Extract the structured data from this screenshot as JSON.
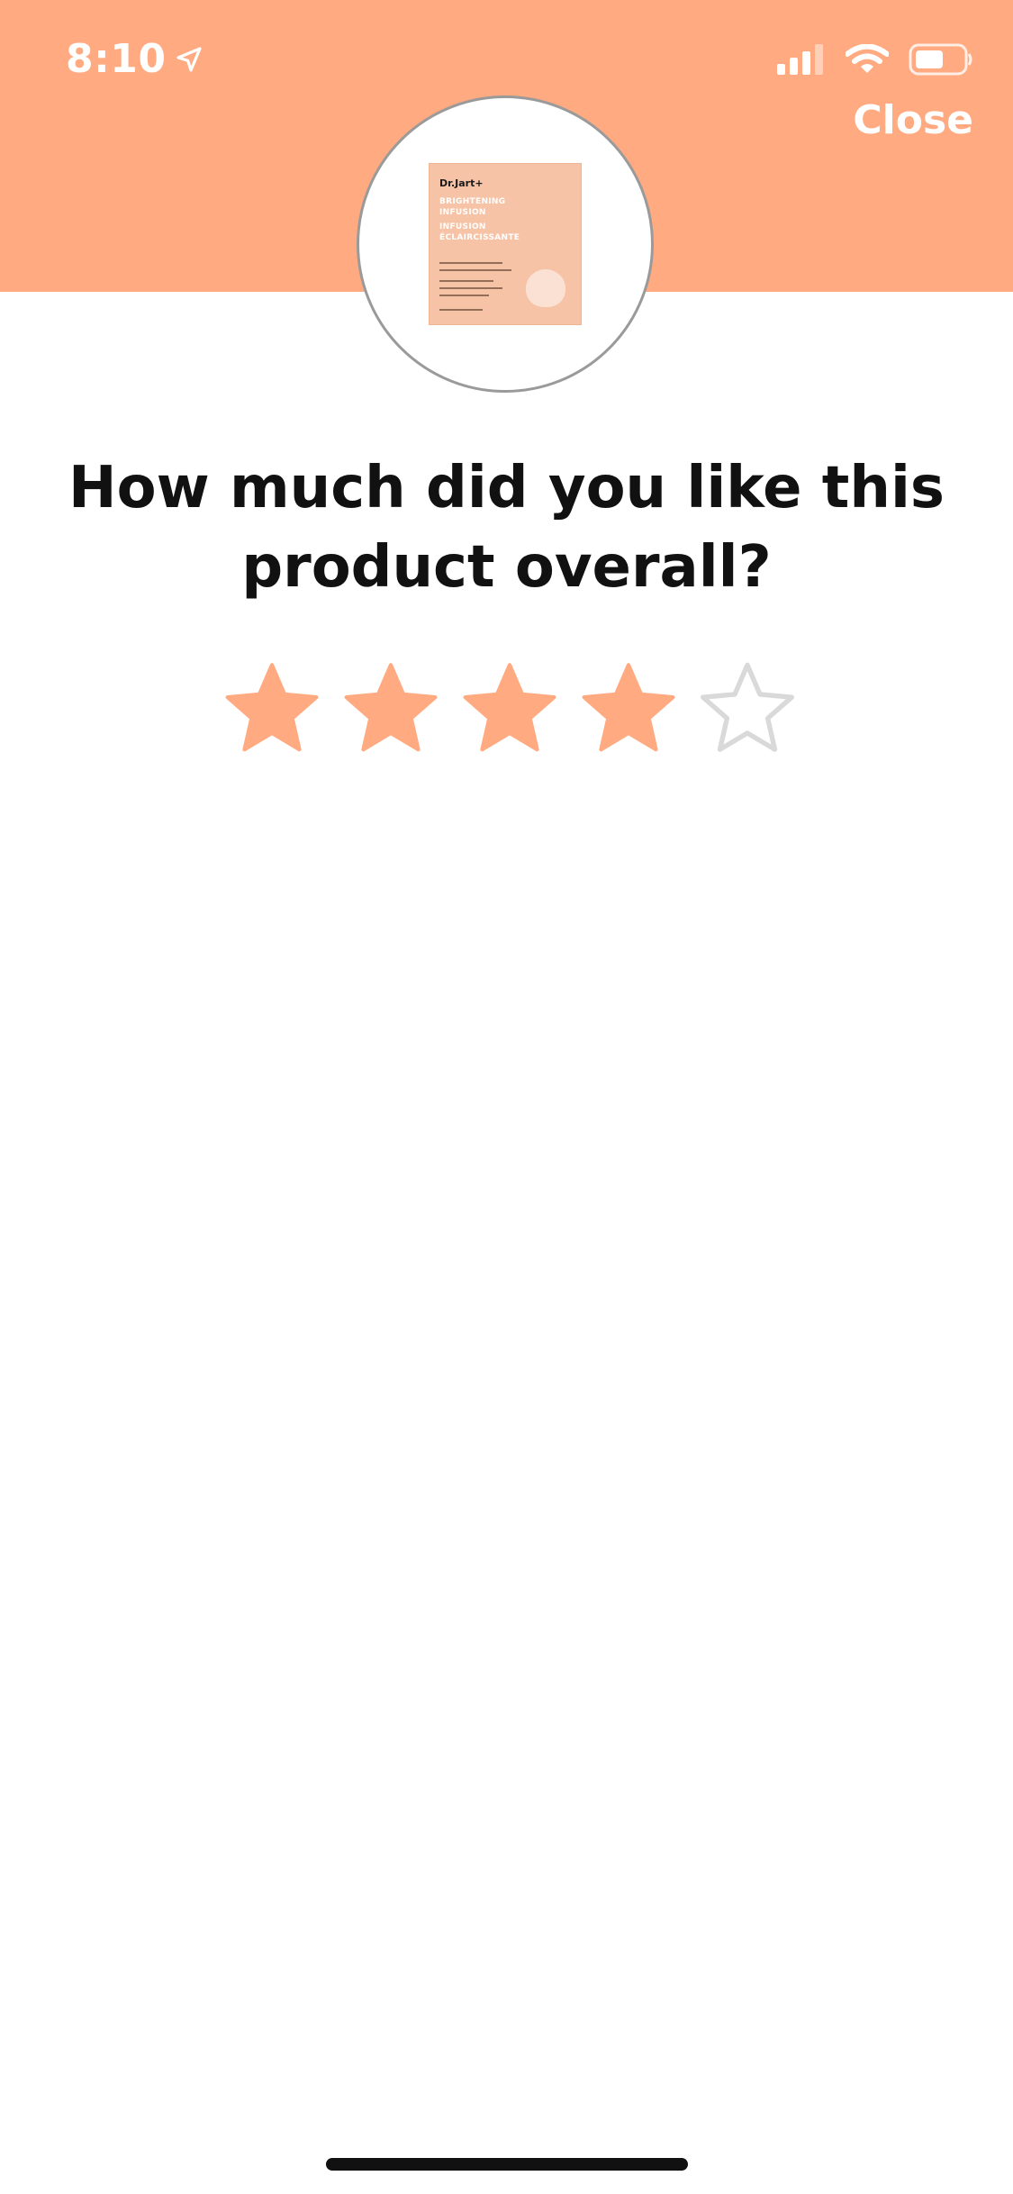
{
  "status_bar": {
    "time": "8:10",
    "location_icon": "location-arrow-icon",
    "signal_icon": "cellular-signal-icon",
    "wifi_icon": "wifi-icon",
    "battery_icon": "battery-icon"
  },
  "header": {
    "close_label": "Close",
    "background_color": "#FFAA80"
  },
  "product": {
    "brand": "Dr.Jart+",
    "line1": "BRIGHTENING",
    "line2": "INFUSION",
    "line3": "INFUSION",
    "line4": "ÉCLAIRCISSANTE"
  },
  "question": {
    "text": "How much did you like this product overall?"
  },
  "rating": {
    "value": 4,
    "max": 5,
    "filled_color": "#FFAA80",
    "empty_color": "#D9D9D9"
  }
}
